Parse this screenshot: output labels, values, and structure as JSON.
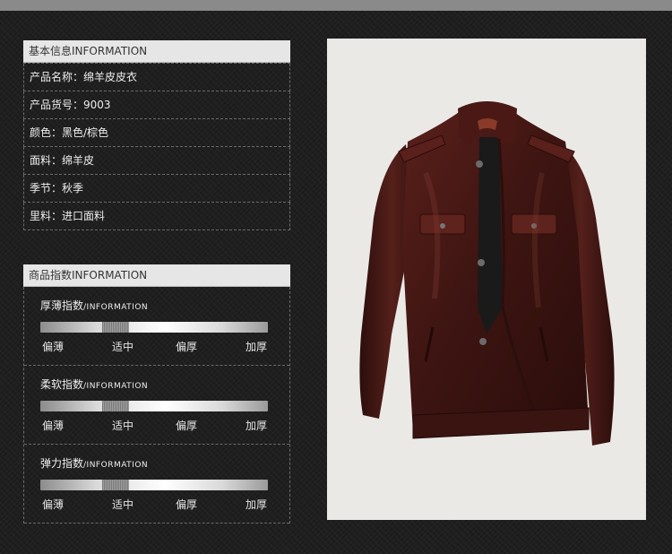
{
  "basic_info": {
    "header": "基本信息INFORMATION",
    "rows": [
      {
        "text": "产品名称：绵羊皮皮衣"
      },
      {
        "text": "产品货号：9003"
      },
      {
        "text": "颜色：黑色/棕色"
      },
      {
        "text": "面料：绵羊皮"
      },
      {
        "text": "季节：秋季"
      },
      {
        "text": "里料：进口面料"
      }
    ]
  },
  "product_index": {
    "header": "商品指数INFORMATION",
    "items": [
      {
        "title": "厚薄指数",
        "title_en": "/INFORMATION",
        "level": 0.33,
        "labels": [
          "偏薄",
          "适中",
          "偏厚",
          "加厚"
        ]
      },
      {
        "title": "柔软指数",
        "title_en": "/INFORMATION",
        "level": 0.33,
        "labels": [
          "偏薄",
          "适中",
          "偏厚",
          "加厚"
        ]
      },
      {
        "title": "弹力指数",
        "title_en": "/INFORMATION",
        "level": 0.33,
        "labels": [
          "偏薄",
          "适中",
          "偏厚",
          "加厚"
        ]
      }
    ]
  },
  "colors": {
    "background": "#1f1f1f",
    "header_bg": "#e6e6e6",
    "jacket_leather": "#4a1a16",
    "photo_bg": "#ebe9e6"
  }
}
